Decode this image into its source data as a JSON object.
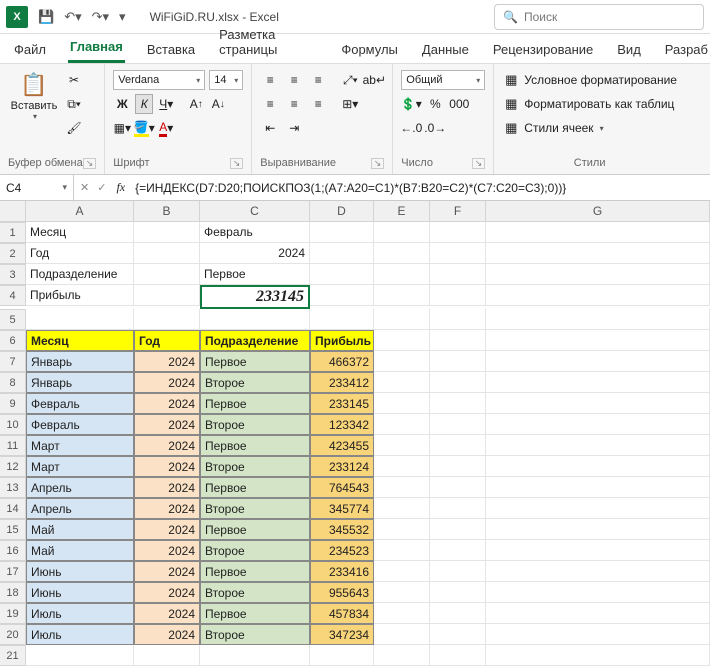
{
  "titlebar": {
    "app_icon": "X",
    "doc_title": "WiFiGiD.RU.xlsx - Excel",
    "search_placeholder": "Поиск"
  },
  "tabs": {
    "file": "Файл",
    "home": "Главная",
    "insert": "Вставка",
    "layout": "Разметка страницы",
    "formulas": "Формулы",
    "data": "Данные",
    "review": "Рецензирование",
    "view": "Вид",
    "dev": "Разраб"
  },
  "ribbon": {
    "clipboard": {
      "paste": "Вставить",
      "label": "Буфер обмена"
    },
    "font": {
      "name": "Verdana",
      "size": "14",
      "label": "Шрифт"
    },
    "align": {
      "label": "Выравнивание"
    },
    "number": {
      "format": "Общий",
      "label": "Число"
    },
    "styles": {
      "cond": "Условное форматирование",
      "table": "Форматировать как таблиц",
      "cell": "Стили ячеек",
      "label": "Стили"
    }
  },
  "namebox": "C4",
  "formula": "{=ИНДЕКС(D7:D20;ПОИСКПОЗ(1;(A7:A20=C1)*(B7:B20=C2)*(C7:C20=C3);0))}",
  "columns": [
    "A",
    "B",
    "C",
    "D",
    "E",
    "F",
    "G"
  ],
  "top_labels": {
    "r1a": "Месяц",
    "r1c": "Февраль",
    "r2a": "Год",
    "r2c": "2024",
    "r3a": "Подразделение",
    "r3c": "Первое",
    "r4a": "Прибыль",
    "r4c": "233145"
  },
  "headers": {
    "month": "Месяц",
    "year": "Год",
    "dept": "Подразделение",
    "profit": "Прибыль"
  },
  "rows": [
    {
      "m": "Январь",
      "y": "2024",
      "d": "Первое",
      "p": "466372"
    },
    {
      "m": "Январь",
      "y": "2024",
      "d": "Второе",
      "p": "233412"
    },
    {
      "m": "Февраль",
      "y": "2024",
      "d": "Первое",
      "p": "233145"
    },
    {
      "m": "Февраль",
      "y": "2024",
      "d": "Второе",
      "p": "123342"
    },
    {
      "m": "Март",
      "y": "2024",
      "d": "Первое",
      "p": "423455"
    },
    {
      "m": "Март",
      "y": "2024",
      "d": "Второе",
      "p": "233124"
    },
    {
      "m": "Апрель",
      "y": "2024",
      "d": "Первое",
      "p": "764543"
    },
    {
      "m": "Апрель",
      "y": "2024",
      "d": "Второе",
      "p": "345774"
    },
    {
      "m": "Май",
      "y": "2024",
      "d": "Первое",
      "p": "345532"
    },
    {
      "m": "Май",
      "y": "2024",
      "d": "Второе",
      "p": "234523"
    },
    {
      "m": "Июнь",
      "y": "2024",
      "d": "Первое",
      "p": "233416"
    },
    {
      "m": "Июнь",
      "y": "2024",
      "d": "Второе",
      "p": "955643"
    },
    {
      "m": "Июль",
      "y": "2024",
      "d": "Первое",
      "p": "457834"
    },
    {
      "m": "Июль",
      "y": "2024",
      "d": "Второе",
      "p": "347234"
    }
  ]
}
